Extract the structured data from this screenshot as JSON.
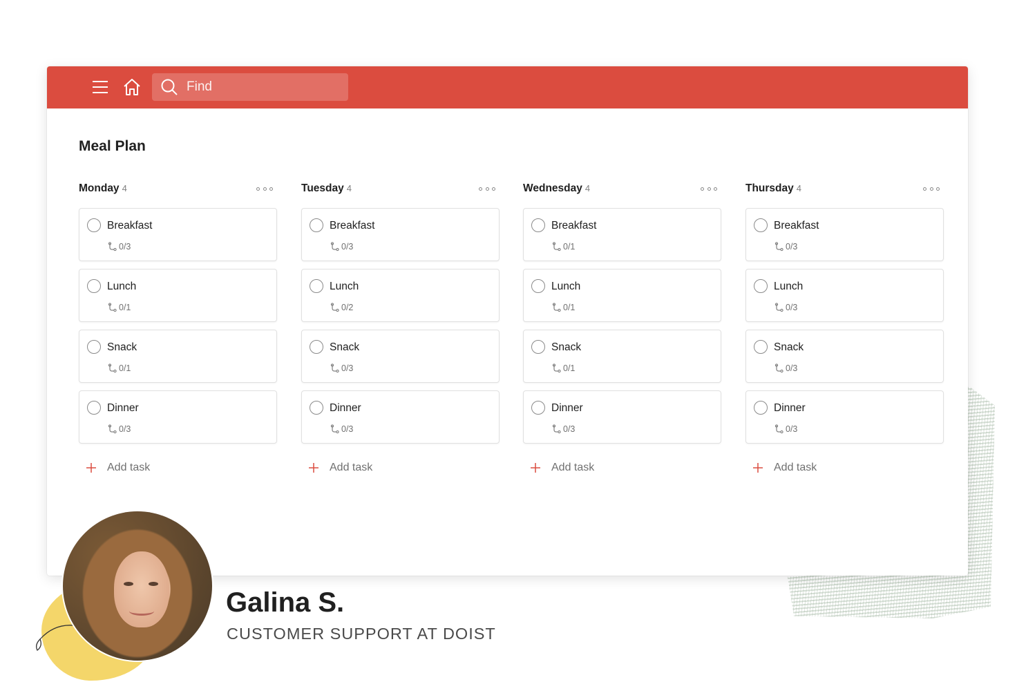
{
  "topbar": {
    "color": "#db4c3f",
    "menu_icon": "hamburger-menu-icon",
    "home_icon": "home-icon",
    "search_placeholder": "Find"
  },
  "project": {
    "title": "Meal Plan"
  },
  "sections": [
    {
      "name": "Monday",
      "count": "4",
      "tasks": [
        {
          "name": "Breakfast",
          "subtasks": "0/3"
        },
        {
          "name": "Lunch",
          "subtasks": "0/1"
        },
        {
          "name": "Snack",
          "subtasks": "0/1"
        },
        {
          "name": "Dinner",
          "subtasks": "0/3"
        }
      ],
      "add_label": "Add task"
    },
    {
      "name": "Tuesday",
      "count": "4",
      "tasks": [
        {
          "name": "Breakfast",
          "subtasks": "0/3"
        },
        {
          "name": "Lunch",
          "subtasks": "0/2"
        },
        {
          "name": "Snack",
          "subtasks": "0/3"
        },
        {
          "name": "Dinner",
          "subtasks": "0/3"
        }
      ],
      "add_label": "Add task"
    },
    {
      "name": "Wednesday",
      "count": "4",
      "tasks": [
        {
          "name": "Breakfast",
          "subtasks": "0/1"
        },
        {
          "name": "Lunch",
          "subtasks": "0/1"
        },
        {
          "name": "Snack",
          "subtasks": "0/1"
        },
        {
          "name": "Dinner",
          "subtasks": "0/3"
        }
      ],
      "add_label": "Add task"
    },
    {
      "name": "Thursday",
      "count": "4",
      "tasks": [
        {
          "name": "Breakfast",
          "subtasks": "0/3"
        },
        {
          "name": "Lunch",
          "subtasks": "0/3"
        },
        {
          "name": "Snack",
          "subtasks": "0/3"
        },
        {
          "name": "Dinner",
          "subtasks": "0/3"
        }
      ],
      "add_label": "Add task"
    }
  ],
  "testimonial": {
    "name": "Galina S.",
    "role": "CUSTOMER SUPPORT AT DOIST"
  }
}
